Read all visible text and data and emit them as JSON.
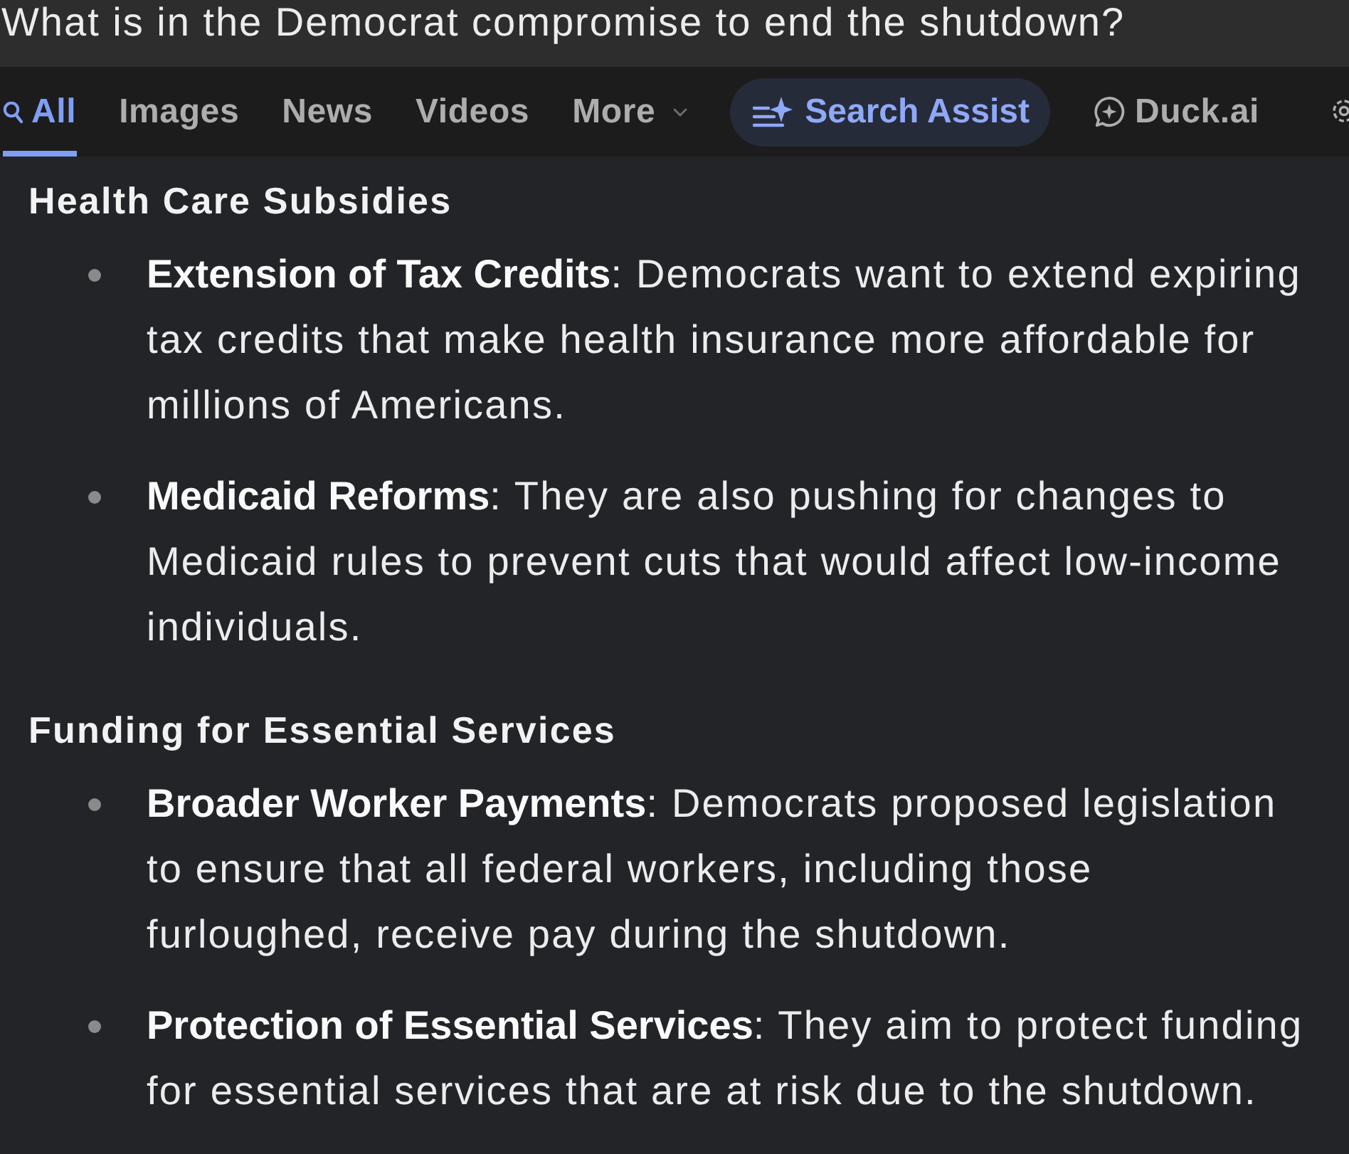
{
  "search": {
    "query": "What is in the Democrat compromise to end the shutdown?"
  },
  "tabs": [
    {
      "label": "All",
      "kind": "search",
      "selected": true
    },
    {
      "label": "Images",
      "kind": "plain",
      "selected": false
    },
    {
      "label": "News",
      "kind": "plain",
      "selected": false
    },
    {
      "label": "Videos",
      "kind": "plain",
      "selected": false
    },
    {
      "label": "More",
      "kind": "dropdown",
      "selected": false
    },
    {
      "label": "Search Assist",
      "kind": "assist",
      "selected": false
    },
    {
      "label": "Duck.ai",
      "kind": "chat",
      "selected": false
    }
  ],
  "sections": [
    {
      "heading": "Health Care Subsidies",
      "items": [
        "**Extension of Tax Credits**: Democrats want to extend expiring tax credits that make health insurance more affordable for millions of Americans.",
        "**Medicaid Reforms**: They are also pushing for changes to Medicaid rules to prevent cuts that would affect low-income individuals."
      ]
    },
    {
      "heading": "Funding for Essential Services",
      "items": [
        "**Broader Worker Payments**: Democrats proposed legislation to ensure that all federal workers, including those furloughed, receive pay during the shutdown.",
        "**Protection of Essential Services**: They aim to protect funding for essential services that are at risk due to the shutdown."
      ]
    }
  ]
}
